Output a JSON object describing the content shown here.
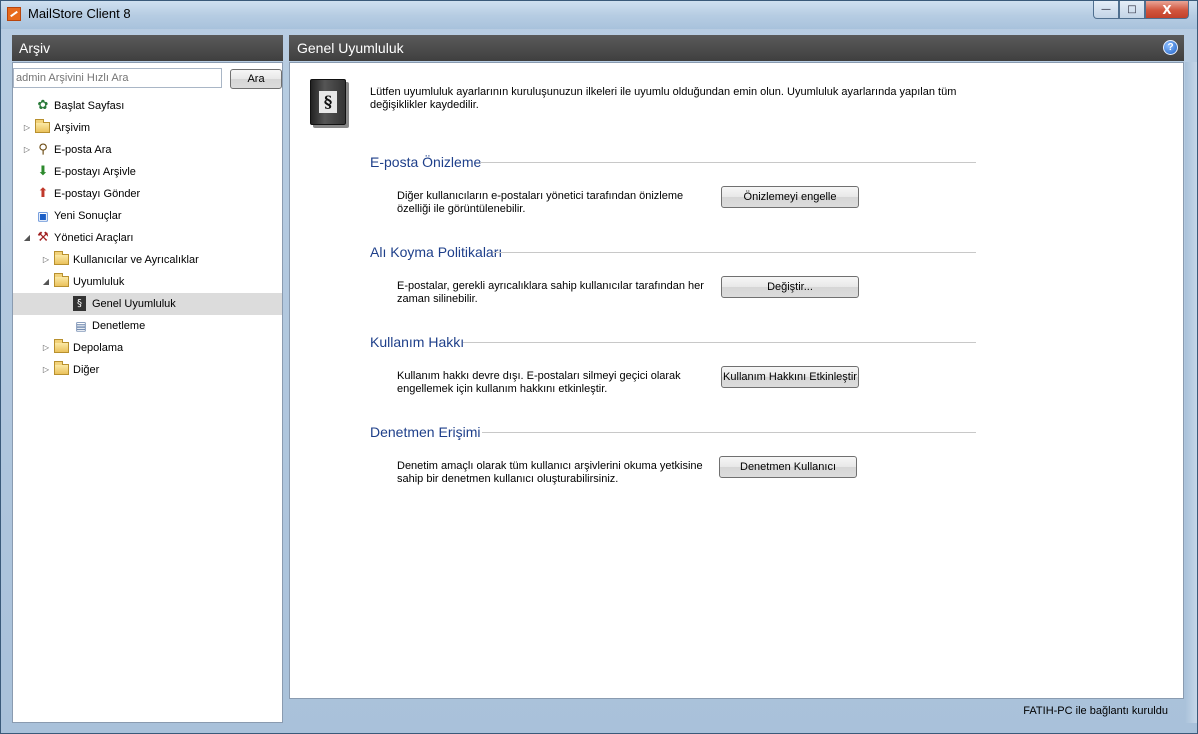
{
  "window": {
    "title": "MailStore Client 8",
    "controls": {
      "minimize": "—",
      "maximize": "□",
      "close": "X"
    }
  },
  "sidebar": {
    "header": "Arşiv",
    "search_placeholder": "admin Arşivini Hızlı Ara",
    "search_button": "Ara",
    "items": [
      {
        "label": "Başlat Sayfası",
        "icon": "home-globe-icon"
      },
      {
        "label": "Arşivim",
        "icon": "folder-icon"
      },
      {
        "label": "E-posta Ara",
        "icon": "magnifier-icon"
      },
      {
        "label": "E-postayı Arşivle",
        "icon": "archive-email-icon"
      },
      {
        "label": "E-postayı Gönder",
        "icon": "send-email-icon"
      },
      {
        "label": "Yeni Sonuçlar",
        "icon": "results-icon"
      },
      {
        "label": "Yönetici Araçları",
        "icon": "admin-tools-icon"
      },
      {
        "label": "Kullanıcılar ve Ayrıcalıklar",
        "icon": "folder-icon"
      },
      {
        "label": "Uyumluluk",
        "icon": "folder-icon"
      },
      {
        "label": "Genel Uyumluluk",
        "icon": "compliance-book-icon"
      },
      {
        "label": "Denetleme",
        "icon": "audit-icon"
      },
      {
        "label": "Depolama",
        "icon": "folder-icon"
      },
      {
        "label": "Diğer",
        "icon": "folder-icon"
      }
    ]
  },
  "main": {
    "header": "Genel Uyumluluk",
    "intro": "Lütfen uyumluluk ayarlarının kuruluşunuzun ilkeleri ile uyumlu olduğundan emin olun. Uyumluluk ayarlarında yapılan tüm değişiklikler kaydedilir.",
    "sections": [
      {
        "title": "E-posta Önizleme",
        "description": "Diğer kullanıcıların e-postaları yönetici tarafından önizleme özelliği ile görüntülenebilir.",
        "button": "Önizlemeyi engelle"
      },
      {
        "title": "Alı Koyma Politikaları",
        "description": "E-postalar, gerekli ayrıcalıklara sahip kullanıcılar tarafından her zaman silinebilir.",
        "button": "Değiştir..."
      },
      {
        "title": "Kullanım Hakkı",
        "description": "Kullanım hakkı devre dışı. E-postaları silmeyi geçici olarak engellemek için kullanım hakkını etkinleştir.",
        "button": "Kullanım Hakkını Etkinleştir"
      },
      {
        "title": "Denetmen Erişimi",
        "description": "Denetim amaçlı olarak tüm kullanıcı arşivlerini okuma yetkisine sahip bir denetmen kullanıcı oluşturabilirsiniz.",
        "button": "Denetmen Kullanıcı"
      }
    ]
  },
  "status": {
    "text": "FATIH-PC ile bağlantı kuruldu"
  },
  "colors": {
    "section_title": "#1e3f8a",
    "panel_header": "#4a4a4a",
    "selected_row": "#dcdcdc"
  }
}
